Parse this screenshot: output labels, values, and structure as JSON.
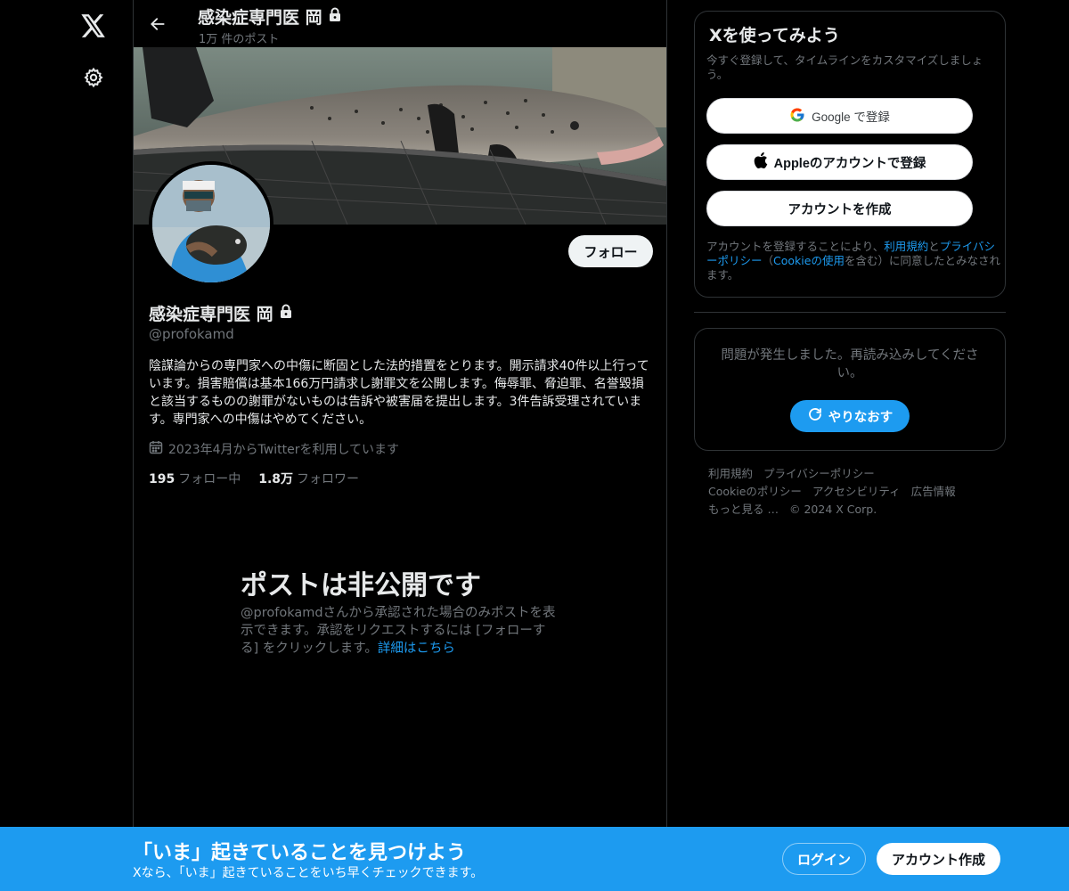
{
  "nav": {
    "logo_icon": "x-logo-icon",
    "settings_icon": "gear-icon"
  },
  "header": {
    "name": "感染症専門医 岡",
    "post_count": "1万 件のポスト"
  },
  "profile": {
    "name": "感染症専門医 岡",
    "handle": "@profokamd",
    "follow_label": "フォロー",
    "bio": "陰謀論からの専門家への中傷に断固とした法的措置をとります。開示請求40件以上行っています。損害賠償は基本166万円請求し謝罪文を公開します。侮辱罪、脅迫罪、名誉毀損と該当するものの謝罪がないものは告訴や被害届を提出します。3件告訴受理されています。専門家への中傷はやめてください。",
    "joined": "2023年4月からTwitterを利用しています",
    "following_count": "195",
    "following_label": "フォロー中",
    "followers_count": "1.8万",
    "followers_label": "フォロワー"
  },
  "private_notice": {
    "title": "ポストは非公開です",
    "text": "@profokamdさんから承認された場合のみポストを表示できます。承認をリクエストするには [フォローする] をクリックします。",
    "link": "詳細はこちら"
  },
  "signup_card": {
    "title": "Xを使ってみよう",
    "subtitle": "今すぐ登録して、タイムラインをカスタマイズしましょう。",
    "google_label": "Google で登録",
    "apple_label": "Appleのアカウントで登録",
    "create_label": "アカウントを作成",
    "terms_prefix": "アカウントを登録することにより、",
    "terms_link1": "利用規約",
    "terms_mid1": "と",
    "terms_link2": "プライバシーポリシー",
    "terms_mid2": "（",
    "terms_link3": "Cookieの使用",
    "terms_suffix": "を含む）に同意したとみなされます。"
  },
  "error_card": {
    "text": "問題が発生しました。再読み込みしてください。",
    "retry_label": "やりなおす"
  },
  "footer": {
    "links": [
      "利用規約",
      "プライバシーポリシー",
      "Cookieのポリシー",
      "アクセシビリティ",
      "広告情報",
      "もっと見る …",
      "© 2024 X Corp."
    ]
  },
  "bottom_bar": {
    "title": "「いま」起きていることを見つけよう",
    "subtitle": "Xなら、「いま」起きていることをいち早くチェックできます。",
    "login_label": "ログイン",
    "signup_label": "アカウント作成"
  },
  "colors": {
    "accent": "#1d9bf0",
    "background": "#000000",
    "text": "#e7e9ea",
    "muted": "#71767b",
    "border": "#2f3336"
  }
}
